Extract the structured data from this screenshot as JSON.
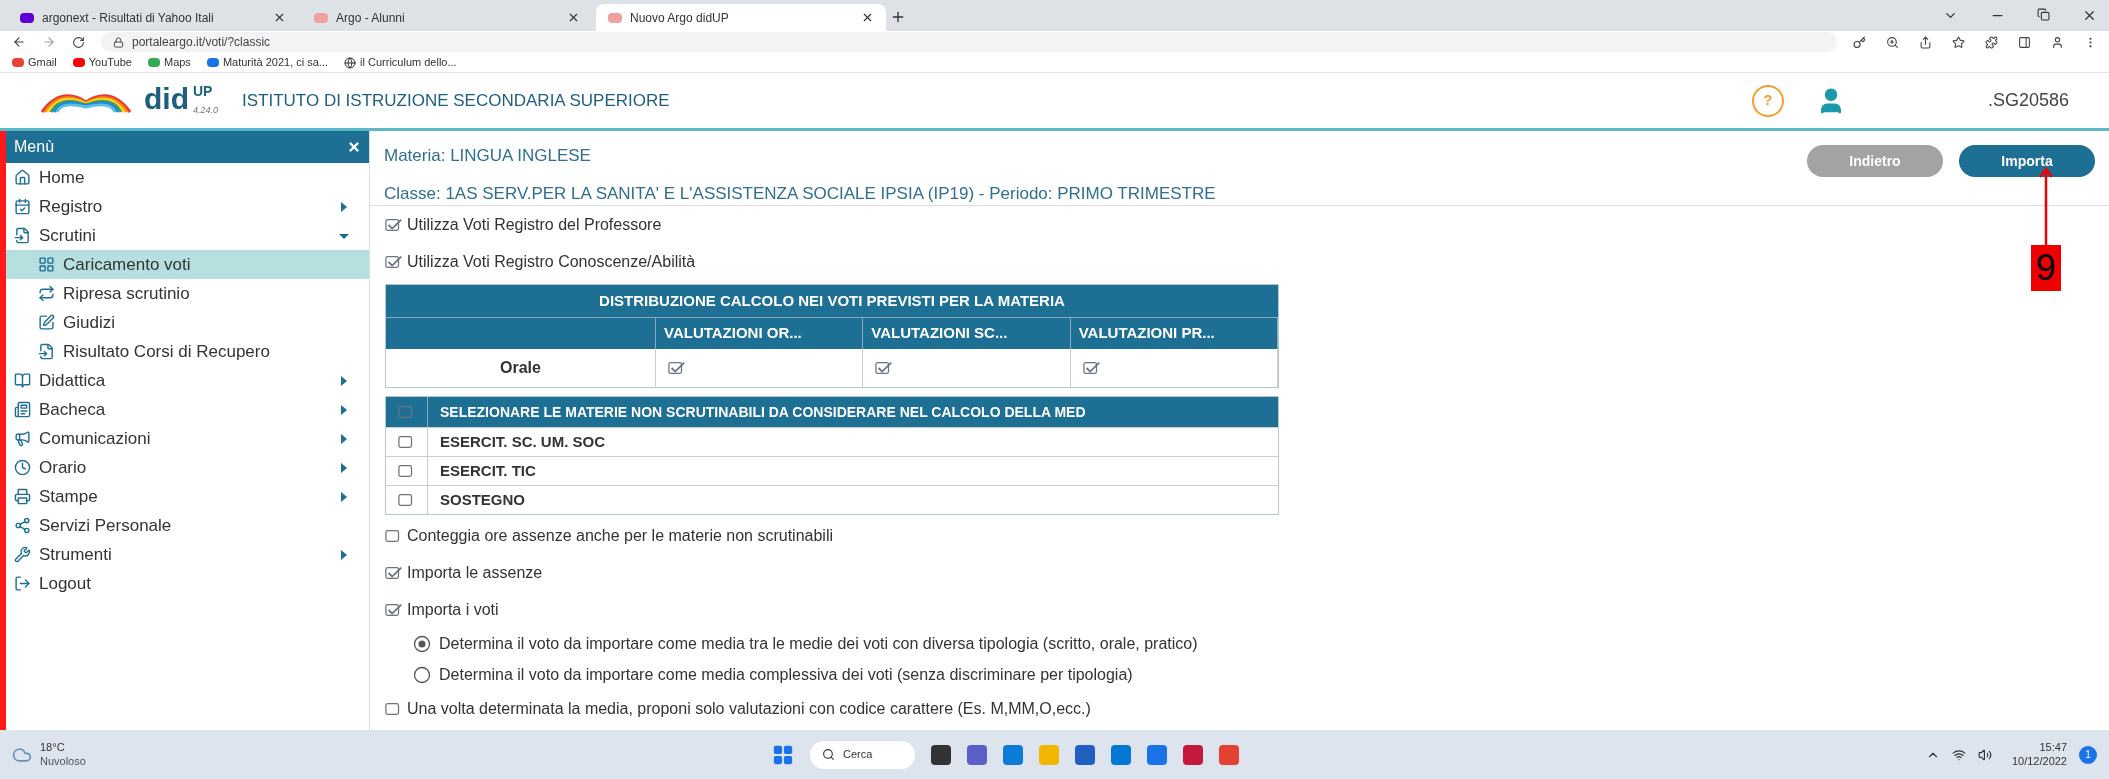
{
  "browser": {
    "tabs": [
      {
        "title": "argonext - Risultati di Yahoo Itali",
        "selected": false
      },
      {
        "title": "Argo - Alunni",
        "selected": false
      },
      {
        "title": "Nuovo Argo didUP",
        "selected": true
      }
    ],
    "address": "portaleargo.it/voti/?classic",
    "bookmarks": [
      "Gmail",
      "YouTube",
      "Maps",
      "Maturità 2021, ci sa...",
      "il Curriculum dello..."
    ]
  },
  "app": {
    "logo": "did",
    "logo_sup": "UP",
    "version": "4.24.0",
    "school": "ISTITUTO DI ISTRUZIONE SECONDARIA SUPERIORE",
    "help": "?",
    "user_code": ".SG20586"
  },
  "sidebar": {
    "title": "Menù",
    "items": [
      {
        "label": "Home",
        "kind": "link",
        "selected": false
      },
      {
        "label": "Registro",
        "kind": "submenu",
        "expanded": false,
        "selected": false
      },
      {
        "label": "Scrutini",
        "kind": "submenu",
        "expanded": true,
        "selected": false,
        "children": [
          {
            "label": "Caricamento voti",
            "selected": true
          },
          {
            "label": "Ripresa scrutinio",
            "selected": false
          },
          {
            "label": "Giudizi",
            "selected": false
          },
          {
            "label": "Risultato Corsi di Recupero",
            "selected": false
          }
        ]
      },
      {
        "label": "Didattica",
        "kind": "submenu",
        "expanded": false,
        "selected": false
      },
      {
        "label": "Bacheca",
        "kind": "submenu",
        "expanded": false,
        "selected": false
      },
      {
        "label": "Comunicazioni",
        "kind": "submenu",
        "expanded": false,
        "selected": false
      },
      {
        "label": "Orario",
        "kind": "submenu",
        "expanded": false,
        "selected": false
      },
      {
        "label": "Stampe",
        "kind": "submenu",
        "expanded": false,
        "selected": false
      },
      {
        "label": "Servizi Personale",
        "kind": "link",
        "selected": false
      },
      {
        "label": "Strumenti",
        "kind": "submenu",
        "expanded": false,
        "selected": false
      },
      {
        "label": "Logout",
        "kind": "link",
        "selected": false
      }
    ]
  },
  "main": {
    "subject": "Materia: LINGUA INGLESE",
    "class_line": "Classe: 1AS SERV.PER LA SANITA' E L'ASSISTENZA SOCIALE IPSIA (IP19) - Periodo: PRIMO TRIMESTRE",
    "buttons": [
      {
        "label": "Indietro",
        "kind": "secondary"
      },
      {
        "label": "Importa",
        "kind": "primary"
      }
    ],
    "annotation": {
      "label": "9"
    },
    "top_options": [
      {
        "label": "Utilizza Voti Registro del Professore",
        "checked": true
      },
      {
        "label": "Utilizza Voti Registro Conoscenze/Abilità",
        "checked": true
      }
    ],
    "distribution": {
      "title": "DISTRIBUZIONE CALCOLO NEI VOTI PREVISTI PER LA MATERIA",
      "columns": [
        "VALUTAZIONI OR...",
        "VALUTAZIONI SC...",
        "VALUTAZIONI PR..."
      ],
      "rows": [
        {
          "label": "Orale",
          "checks": [
            true,
            true,
            true
          ]
        }
      ]
    },
    "subjects": {
      "header": "SELEZIONARE LE MATERIE NON SCRUTINABILI DA CONSIDERARE NEL CALCOLO DELLA MED",
      "header_checked": false,
      "rows": [
        {
          "label": "ESERCIT. SC. UM. SOC",
          "checked": false
        },
        {
          "label": "ESERCIT. TIC",
          "checked": false
        },
        {
          "label": "SOSTEGNO",
          "checked": false
        }
      ]
    },
    "options": [
      {
        "kind": "checkbox",
        "label": "Conteggia ore assenze anche per le materie non scrutinabili",
        "checked": false
      },
      {
        "kind": "checkbox",
        "label": "Importa le assenze",
        "checked": true
      },
      {
        "kind": "checkbox",
        "label": "Importa i voti",
        "checked": true
      },
      {
        "kind": "radio",
        "label": "Determina il voto da importare come media tra le medie dei voti con diversa tipologia (scritto, orale, pratico)",
        "selected": true
      },
      {
        "kind": "radio",
        "label": "Determina il voto da importare come media complessiva dei voti (senza discriminare per tipologia)",
        "selected": false
      },
      {
        "kind": "checkbox",
        "label": "Una volta determinata la media, proponi solo valutazioni con codice carattere (Es. M,MM,O,ecc.)",
        "checked": false
      }
    ]
  },
  "taskbar": {
    "temperature": "18°C",
    "weather": "Nuvoloso",
    "search": "Cerca",
    "time": "15:47",
    "date": "10/12/2022",
    "notifications": "1"
  }
}
